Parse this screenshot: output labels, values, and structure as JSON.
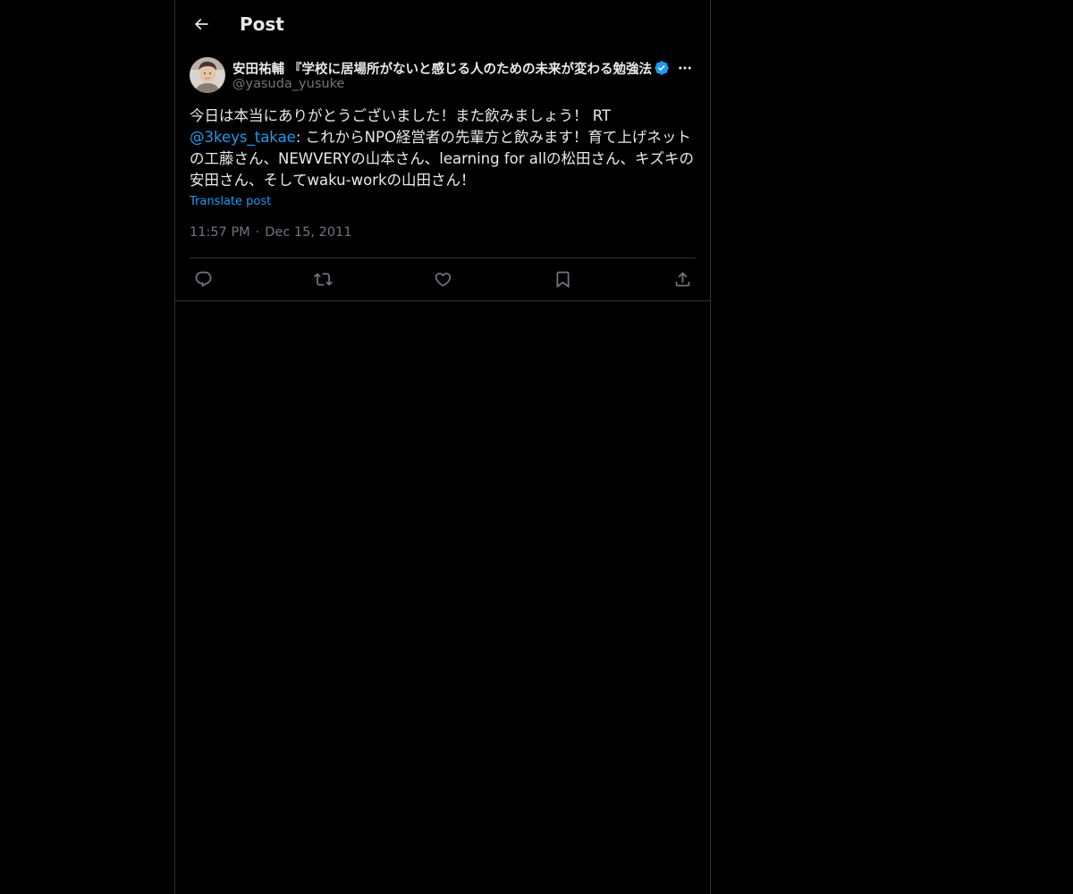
{
  "header": {
    "title": "Post",
    "back_icon": "arrow-left-icon"
  },
  "post": {
    "author": {
      "display_name": "安田祐輔 『学校に居場所がないと感じる人のための未来が変わる勉強法",
      "handle": "@yasuda_yusuke",
      "verified": true,
      "verified_color": "#1d9bf0"
    },
    "text_part1": "今日は本当にありがとうございました！また飲みましょう！ RT ",
    "mention": "@3keys_takae",
    "text_part2": ": これからNPO経営者の先輩方と飲みます！育て上げネットの工藤さん、NEWVERYの山本さん、learning for allの松田さん、キズキの安田さん、そしてwaku-workの山田さん！",
    "translate_label": "Translate post",
    "time": "11:57 PM",
    "separator": "·",
    "date": "Dec 15, 2011"
  },
  "actions": [
    {
      "name": "reply-icon"
    },
    {
      "name": "repost-icon"
    },
    {
      "name": "like-icon"
    },
    {
      "name": "bookmark-icon"
    },
    {
      "name": "share-icon"
    }
  ],
  "colors": {
    "background": "#000000",
    "text": "#e7e9ea",
    "secondary": "#71767b",
    "accent": "#1d9bf0",
    "border": "#2f3336"
  }
}
